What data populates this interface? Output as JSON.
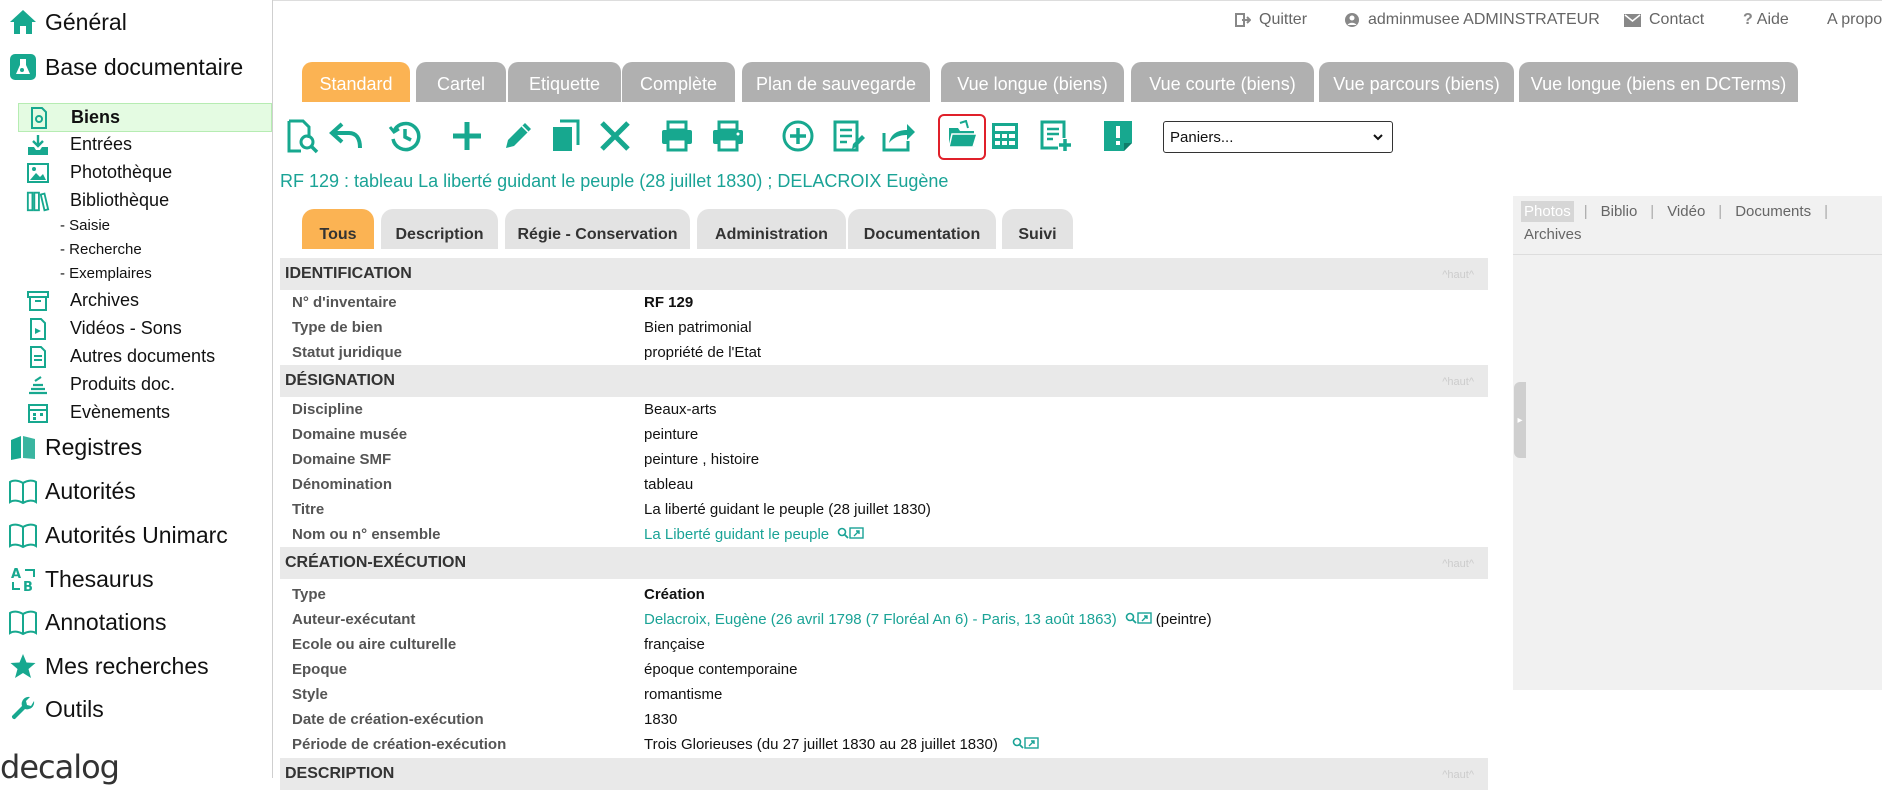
{
  "sidebar": {
    "top_items": [
      {
        "label": "Général",
        "icon": "home-icon"
      },
      {
        "label": "Base documentaire",
        "icon": "flask-icon"
      },
      {
        "label": "Registres",
        "icon": "books-icon"
      },
      {
        "label": "Autorités",
        "icon": "open-book-icon"
      },
      {
        "label": "Autorités Unimarc",
        "icon": "open-book-icon"
      },
      {
        "label": "Thesaurus",
        "icon": "translate-icon"
      },
      {
        "label": "Annotations",
        "icon": "open-book-icon"
      },
      {
        "label": "Mes recherches",
        "icon": "star-icon"
      },
      {
        "label": "Outils",
        "icon": "wrench-icon"
      }
    ],
    "sub_items": [
      {
        "label": "Biens",
        "icon": "object-icon",
        "active": true
      },
      {
        "label": "Entrées",
        "icon": "inbox-download-icon"
      },
      {
        "label": "Photothèque",
        "icon": "image-icon"
      },
      {
        "label": "Bibliothèque",
        "icon": "library-icon"
      },
      {
        "label": "Archives",
        "icon": "archive-box-icon"
      },
      {
        "label": "Vidéos - Sons",
        "icon": "video-file-icon"
      },
      {
        "label": "Autres documents",
        "icon": "document-icon"
      },
      {
        "label": "Produits doc.",
        "icon": "stack-icon"
      },
      {
        "label": "Evènements",
        "icon": "calendar-icon"
      }
    ],
    "library_sub_items": [
      "- Saisie",
      "- Recherche",
      "- Exemplaires"
    ],
    "logo": "decalog"
  },
  "topbar": {
    "quit": "Quitter",
    "user": "adminmusee ADMINSTRATEUR",
    "contact": "Contact",
    "help": "Aide",
    "about": "A propos"
  },
  "view_tabs": [
    {
      "label": "Standard",
      "active": true
    },
    {
      "label": "Cartel"
    },
    {
      "label": "Etiquette"
    },
    {
      "label": "Complète"
    },
    {
      "label": "Plan de sauvegarde"
    },
    {
      "label": "Vue longue (biens)"
    },
    {
      "label": "Vue courte (biens)"
    },
    {
      "label": "Vue parcours (biens)"
    },
    {
      "label": "Vue longue (biens en DCTerms)"
    }
  ],
  "toolbar": {
    "buttons": [
      {
        "name": "search-record-icon"
      },
      {
        "name": "back-icon"
      },
      {
        "name": "history-icon"
      },
      {
        "name": "add-icon"
      },
      {
        "name": "edit-icon"
      },
      {
        "name": "duplicate-icon"
      },
      {
        "name": "delete-icon"
      },
      {
        "name": "print-icon"
      },
      {
        "name": "print-alt-icon"
      },
      {
        "name": "add-circle-icon"
      },
      {
        "name": "edit-list-icon"
      },
      {
        "name": "export-icon"
      },
      {
        "name": "open-folder-icon",
        "highlighted": true
      },
      {
        "name": "calculator-icon"
      },
      {
        "name": "new-document-icon"
      },
      {
        "name": "alert-note-icon"
      }
    ],
    "basket_select": "Paniers..."
  },
  "record_title": "RF 129 : tableau La liberté guidant le peuple (28 juillet 1830) ; DELACROIX Eugène",
  "section_tabs": [
    {
      "label": "Tous",
      "active": true
    },
    {
      "label": "Description"
    },
    {
      "label": "Régie - Conservation"
    },
    {
      "label": "Administration"
    },
    {
      "label": "Documentation"
    },
    {
      "label": "Suivi"
    }
  ],
  "haut_label": "^haut^",
  "sections": [
    {
      "title": "IDENTIFICATION",
      "rows": [
        {
          "label": "N° d'inventaire",
          "value": "RF 129",
          "bold": true
        },
        {
          "label": "Type de bien",
          "value": "Bien patrimonial"
        },
        {
          "label": "Statut juridique",
          "value": "propriété de l'Etat"
        }
      ]
    },
    {
      "title": "DÉSIGNATION",
      "rows": [
        {
          "label": "Discipline",
          "value": "Beaux-arts"
        },
        {
          "label": "Domaine musée",
          "value": "peinture"
        },
        {
          "label": "Domaine SMF",
          "value": "peinture , histoire"
        },
        {
          "label": "Dénomination",
          "value": "tableau"
        },
        {
          "label": "Titre",
          "value": "La liberté guidant le peuple (28 juillet 1830)"
        },
        {
          "label": "Nom ou n° ensemble",
          "value": "La Liberté guidant le peuple",
          "link": true,
          "icons": true
        }
      ]
    },
    {
      "title": "CRÉATION-EXÉCUTION",
      "rows": [
        {
          "label": "Type",
          "value": "Création",
          "bold": true
        },
        {
          "label": "Auteur-exécutant",
          "value": "Delacroix, Eugène (26 avril 1798 (7 Floréal An 6) - Paris, 13 août 1863)",
          "link": true,
          "icons": true,
          "extra": "(peintre)"
        },
        {
          "label": "Ecole ou aire culturelle",
          "value": "française"
        },
        {
          "label": "Epoque",
          "value": "époque contemporaine"
        },
        {
          "label": "Style",
          "value": "romantisme"
        },
        {
          "label": "Date de création-exécution",
          "value": "1830"
        },
        {
          "label": "Période de création-exécution",
          "value": "Trois Glorieuses (du 27 juillet 1830 au 28 juillet 1830)",
          "icons": true
        }
      ]
    },
    {
      "title": "DESCRIPTION",
      "rows": []
    }
  ],
  "media_panel": {
    "tabs": [
      {
        "label": "Photos",
        "active": true
      },
      {
        "label": "Biblio"
      },
      {
        "label": "Vidéo"
      },
      {
        "label": "Documents"
      },
      {
        "label": "Archives"
      }
    ]
  },
  "colors": {
    "accent_orange": "#fbb353",
    "tab_grey": "#b0b0b0",
    "teal": "#1aa396",
    "green_icon": "#17a88f"
  }
}
